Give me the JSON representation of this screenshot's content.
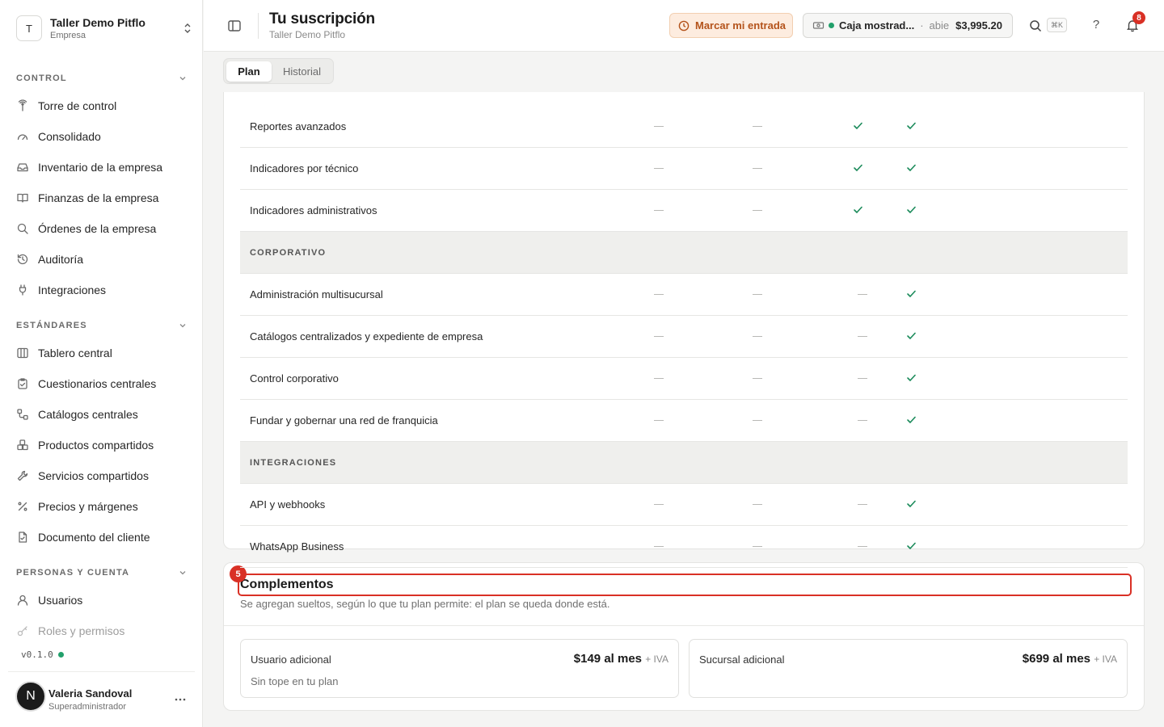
{
  "workspace": {
    "avatar": "T",
    "name": "Taller Demo Pitflo",
    "type": "Empresa"
  },
  "sidebar": {
    "sections": [
      {
        "label": "CONTROL",
        "items": [
          {
            "label": "Torre de control",
            "icon": "tower-icon"
          },
          {
            "label": "Consolidado",
            "icon": "gauge-icon"
          },
          {
            "label": "Inventario de la empresa",
            "icon": "inbox-icon"
          },
          {
            "label": "Finanzas de la empresa",
            "icon": "book-icon"
          },
          {
            "label": "Órdenes de la empresa",
            "icon": "search-icon"
          },
          {
            "label": "Auditoría",
            "icon": "history-icon"
          },
          {
            "label": "Integraciones",
            "icon": "plug-icon"
          }
        ]
      },
      {
        "label": "ESTÁNDARES",
        "items": [
          {
            "label": "Tablero central",
            "icon": "columns-icon"
          },
          {
            "label": "Cuestionarios centrales",
            "icon": "clipboard-icon"
          },
          {
            "label": "Catálogos centrales",
            "icon": "workflow-icon"
          },
          {
            "label": "Productos compartidos",
            "icon": "boxes-icon"
          },
          {
            "label": "Servicios compartidos",
            "icon": "wrench-icon"
          },
          {
            "label": "Precios y márgenes",
            "icon": "percent-icon"
          },
          {
            "label": "Documento del cliente",
            "icon": "file-icon"
          }
        ]
      },
      {
        "label": "PERSONAS Y CUENTA",
        "items": [
          {
            "label": "Usuarios",
            "icon": "user-icon"
          },
          {
            "label": "Roles y permisos",
            "icon": "key-icon"
          }
        ]
      }
    ],
    "version": "v0.1.0"
  },
  "user": {
    "avatar": "N",
    "name": "Valeria Sandoval",
    "role": "Superadministrador"
  },
  "topbar": {
    "title": "Tu suscripción",
    "subtitle": "Taller Demo Pitflo",
    "entry_button": "Marcar mi entrada",
    "cash": {
      "name": "Caja mostrad...",
      "sep": "·",
      "status": "abie",
      "amount": "$3,995.20"
    },
    "kbd": "⌘K",
    "help": "?",
    "notifications": "8"
  },
  "tabs": [
    {
      "label": "Plan",
      "active": true
    },
    {
      "label": "Historial",
      "active": false
    }
  ],
  "features": [
    {
      "name": "Reportes avanzados",
      "type": "row",
      "plans": [
        false,
        false,
        true,
        true
      ]
    },
    {
      "name": "Indicadores por técnico",
      "type": "row",
      "plans": [
        false,
        false,
        true,
        true
      ]
    },
    {
      "name": "Indicadores administrativos",
      "type": "row",
      "plans": [
        false,
        false,
        true,
        true
      ]
    },
    {
      "name": "CORPORATIVO",
      "type": "category"
    },
    {
      "name": "Administración multisucursal",
      "type": "row",
      "plans": [
        false,
        false,
        false,
        true
      ]
    },
    {
      "name": "Catálogos centralizados y expediente de empresa",
      "type": "row",
      "plans": [
        false,
        false,
        false,
        true
      ]
    },
    {
      "name": "Control corporativo",
      "type": "row",
      "plans": [
        false,
        false,
        false,
        true
      ]
    },
    {
      "name": "Fundar y gobernar una red de franquicia",
      "type": "row",
      "plans": [
        false,
        false,
        false,
        true
      ]
    },
    {
      "name": "INTEGRACIONES",
      "type": "category"
    },
    {
      "name": "API y webhooks",
      "type": "row",
      "plans": [
        false,
        false,
        false,
        true
      ]
    },
    {
      "name": "WhatsApp Business",
      "type": "row",
      "plans": [
        false,
        false,
        false,
        true
      ]
    }
  ],
  "addons": {
    "step": "5",
    "title": "Complementos",
    "description": "Se agregan sueltos, según lo que tu plan permite: el plan se queda donde está.",
    "items": [
      {
        "title": "Usuario adicional",
        "price": "$149 al mes",
        "tax": "+ IVA",
        "note": "Sin tope en tu plan"
      },
      {
        "title": "Sucursal adicional",
        "price": "$699 al mes",
        "tax": "+ IVA",
        "note": ""
      }
    ]
  },
  "colors": {
    "accent_red": "#d93025",
    "check_green": "#1a8a5a",
    "entry_bg": "#fdecdf",
    "entry_text": "#b4531b"
  }
}
